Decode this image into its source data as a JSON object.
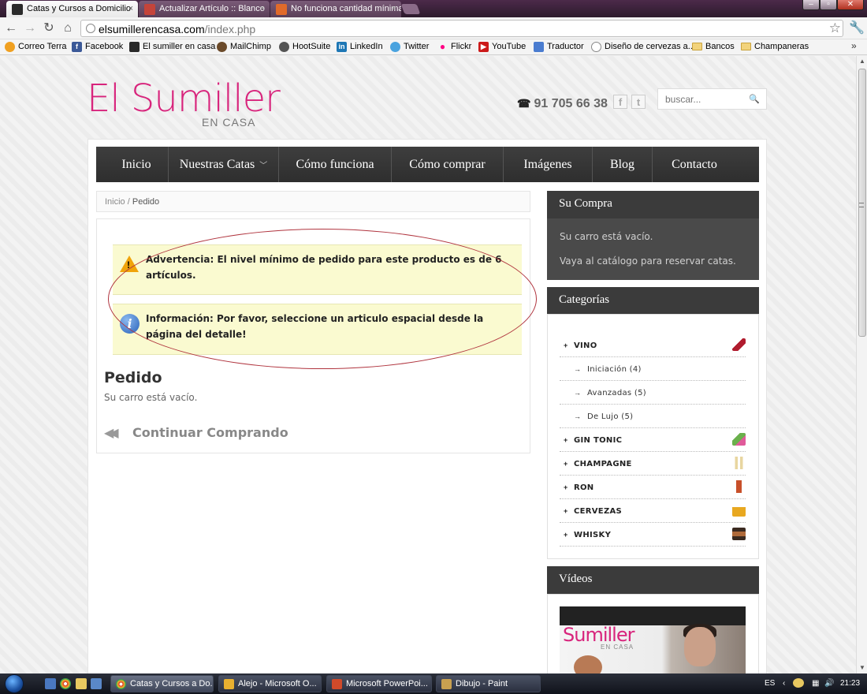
{
  "browser": {
    "tabs": [
      {
        "title": "Catas y Cursos a Domicilio",
        "active": true
      },
      {
        "title": "Actualizar Artículo :: Blanco",
        "active": false
      },
      {
        "title": "No funciona cantidad mínima",
        "active": false
      }
    ],
    "tab_close": "×",
    "url_host": "elsumillerencasa.com",
    "url_path": "/index.php",
    "bookmarks": [
      "Correo Terra",
      "Facebook",
      "El sumiller en casa",
      "MailChimp",
      "HootSuite",
      "LinkedIn",
      "Twitter",
      "Flickr",
      "YouTube",
      "Traductor",
      "Diseño de cervezas a...",
      "Bancos",
      "Champaneras"
    ],
    "bookmarks_more": "»"
  },
  "header": {
    "logo": "El Sumiller",
    "logo_sub": "EN CASA",
    "phone": "91 705 66 38",
    "social_facebook": "f",
    "social_twitter": "t",
    "search_placeholder": "buscar..."
  },
  "nav": {
    "items": [
      "Inicio",
      "Nuestras Catas",
      "Cómo funciona",
      "Cómo comprar",
      "Imágenes",
      "Blog",
      "Contacto"
    ]
  },
  "breadcrumb": {
    "home": "Inicio",
    "separator": "/",
    "current": "Pedido"
  },
  "messages": {
    "warning": "Advertencia: El nivel mínimo de pedido para este producto es de 6 artículos.",
    "info": "Información: Por favor, seleccione un articulo espacial desde la página del detalle!"
  },
  "order": {
    "title": "Pedido",
    "empty": "Su carro está vacío.",
    "continue": "Continuar Comprando"
  },
  "sidebar": {
    "cart_title": "Su Compra",
    "cart_empty": "Su carro está vacío.",
    "cart_hint": "Vaya al catálogo para reservar catas.",
    "categories_title": "Categorías",
    "categories": [
      {
        "label": "VINO",
        "sub": false
      },
      {
        "label": "Iniciación (4)",
        "sub": true
      },
      {
        "label": "Avanzadas (5)",
        "sub": true
      },
      {
        "label": "De Lujo (5)",
        "sub": true
      },
      {
        "label": "GIN TONIC",
        "sub": false
      },
      {
        "label": "CHAMPAGNE",
        "sub": false
      },
      {
        "label": "RON",
        "sub": false
      },
      {
        "label": "CERVEZAS",
        "sub": false
      },
      {
        "label": "WHISKY",
        "sub": false
      }
    ],
    "videos_title": "Vídeos",
    "video_logo": "Sumiller",
    "video_sub": "EN CASA"
  },
  "taskbar": {
    "tasks": [
      "Catas y Cursos a Do...",
      "Alejo - Microsoft O...",
      "Microsoft PowerPoi...",
      "Dibujo - Paint"
    ],
    "lang": "ES",
    "time": "21:23"
  }
}
